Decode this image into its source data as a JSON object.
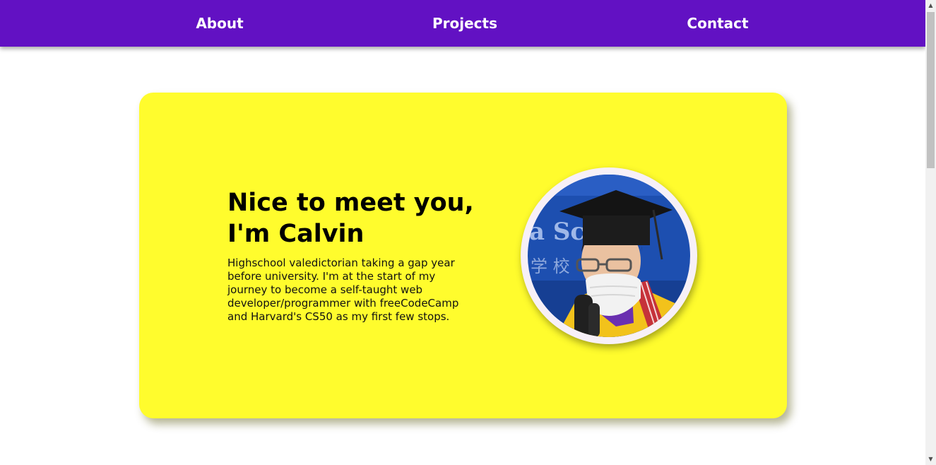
{
  "nav": {
    "items": [
      {
        "label": "About"
      },
      {
        "label": "Projects"
      },
      {
        "label": "Contact"
      }
    ]
  },
  "hero": {
    "title": "Nice to meet you, I'm Calvin",
    "description": "Highschool valedictorian taking a gap year before university. I'm at the start of my journey to become a self-taught web developer/programmer with freeCodeCamp and Harvard's CS50 as my first few stops.",
    "avatar_alt": "graduation-photo",
    "banner_text": "a Sc"
  },
  "colors": {
    "nav_background": "#6211c3",
    "card_background": "#fffc2d",
    "nav_text": "#ffffff"
  }
}
